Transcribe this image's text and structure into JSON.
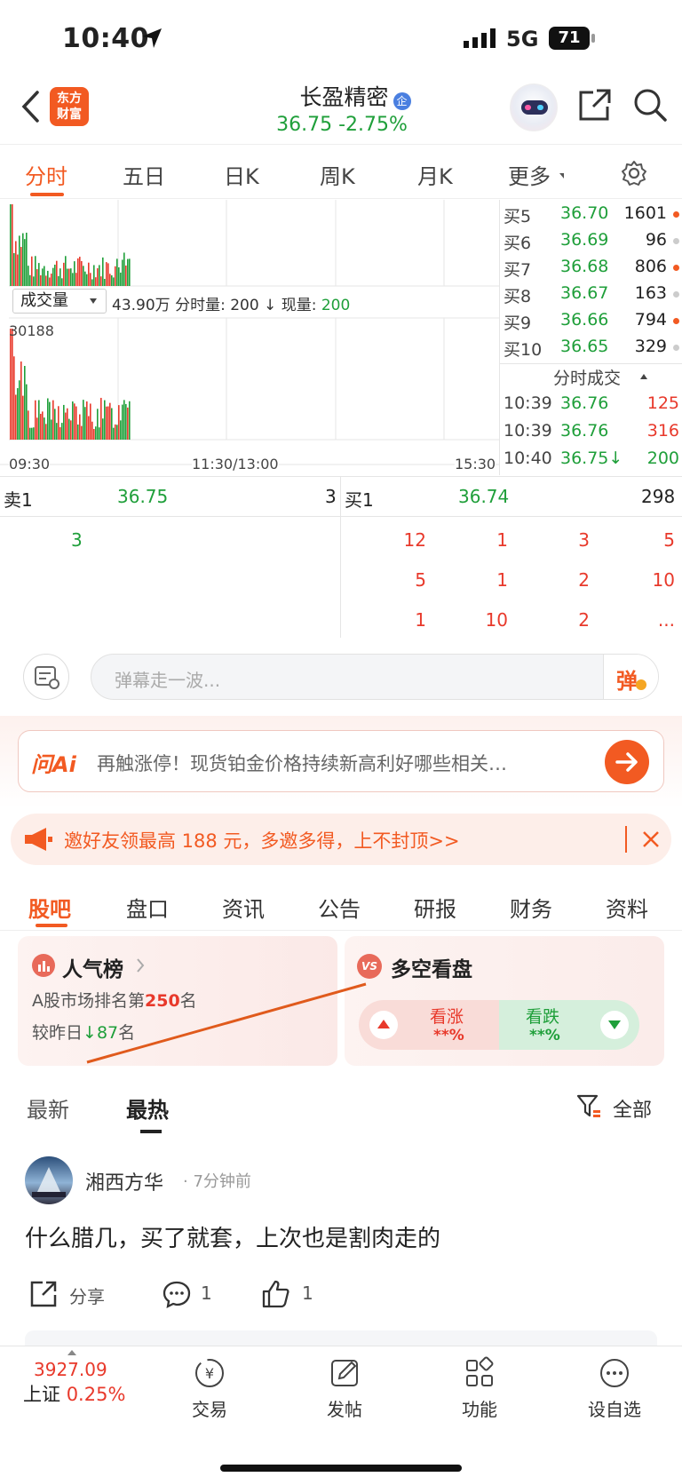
{
  "status": {
    "time": "10:40",
    "network": "5G",
    "battery": "71"
  },
  "header": {
    "brand_line1": "东方",
    "brand_line2": "财富",
    "stock_name": "长盈精密",
    "badge": "企",
    "price": "36.75",
    "change": "-2.75%"
  },
  "tabs": [
    "分时",
    "五日",
    "日K",
    "周K",
    "月K",
    "更多"
  ],
  "chart": {
    "volume_selector": "成交量",
    "volume_info_prefix": "43.90万 分时量: 200 ↓ 现量: ",
    "volume_info_now": "200",
    "volume_max_label": "30188",
    "x_labels": [
      "09:30",
      "11:30/13:00",
      "15:30"
    ]
  },
  "orderbook": {
    "bids": [
      {
        "label": "买5",
        "price": "36.70",
        "vol": "1601",
        "dot": "orange"
      },
      {
        "label": "买6",
        "price": "36.69",
        "vol": "96",
        "dot": "gray"
      },
      {
        "label": "买7",
        "price": "36.68",
        "vol": "806",
        "dot": "orange"
      },
      {
        "label": "买8",
        "price": "36.67",
        "vol": "163",
        "dot": "gray"
      },
      {
        "label": "买9",
        "price": "36.66",
        "vol": "794",
        "dot": "orange"
      },
      {
        "label": "买10",
        "price": "36.65",
        "vol": "329",
        "dot": "gray"
      }
    ],
    "ticks_header": "分时成交",
    "ticks": [
      {
        "time": "10:39",
        "price": "36.76",
        "vol": "125",
        "color": "red"
      },
      {
        "time": "10:39",
        "price": "36.76",
        "vol": "316",
        "color": "red"
      },
      {
        "time": "10:40",
        "price": "36.75↓",
        "vol": "200",
        "color": "green"
      }
    ]
  },
  "quote": {
    "sell_label": "卖1",
    "sell_price": "36.75",
    "sell_vol": "3",
    "buy_label": "买1",
    "buy_price": "36.74",
    "buy_vol": "298"
  },
  "queue": {
    "left": [
      "3"
    ],
    "right": [
      [
        "12",
        "1",
        "3",
        "5"
      ],
      [
        "5",
        "1",
        "2",
        "10"
      ],
      [
        "1",
        "10",
        "2",
        "..."
      ]
    ]
  },
  "danmu": {
    "placeholder": "弹幕走一波...",
    "button": "弹"
  },
  "ask": {
    "logo": "问Ai",
    "text": "再触涨停！现货铂金价格持续新高利好哪些相关…"
  },
  "invite": {
    "text": "邀好友领最高 188 元，多邀多得，上不封顶>>"
  },
  "news_tabs": [
    "股吧",
    "盘口",
    "资讯",
    "公告",
    "研报",
    "财务",
    "资料"
  ],
  "popularity": {
    "title": "人气榜",
    "rank_prefix": "A股市场排名第",
    "rank": "250",
    "rank_suffix": "名",
    "change_prefix": "较昨日",
    "change": "87",
    "change_suffix": "名"
  },
  "sentiment": {
    "title": "多空看盘",
    "bull": "看涨",
    "bull_val": "**%",
    "bear": "看跌",
    "bear_val": "**%"
  },
  "feed": {
    "tabs": [
      "最新",
      "最热"
    ],
    "filter": "全部"
  },
  "post": {
    "author": "湘西方华",
    "time": "· 7分钟前",
    "content": "什么腊几，买了就套，上次也是割肉走的",
    "share": "分享",
    "comments": "1",
    "likes": "1"
  },
  "bottom": {
    "index_value": "3927.09",
    "index_name": "上证",
    "index_change": "0.25%",
    "items": [
      "交易",
      "发帖",
      "功能",
      "设自选"
    ]
  }
}
